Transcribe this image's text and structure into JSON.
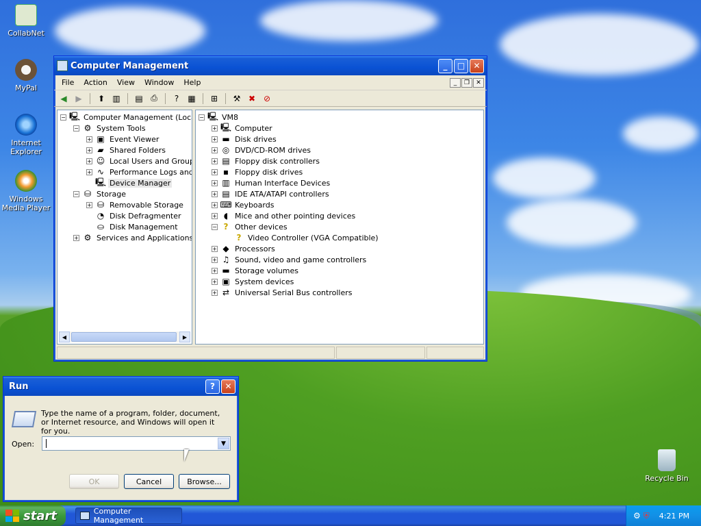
{
  "desktop": {
    "icons": [
      {
        "label": "CollabNet"
      },
      {
        "label": "MyPal"
      },
      {
        "label": "Internet Explorer"
      },
      {
        "label": "Windows Media Player"
      },
      {
        "label": "Recycle Bin"
      }
    ]
  },
  "cm_window": {
    "title": "Computer Management",
    "menu": [
      "File",
      "Action",
      "View",
      "Window",
      "Help"
    ],
    "left_tree": [
      {
        "label": "Computer Management (Local)",
        "level": 0,
        "expander": "-",
        "icon": "computer-icon"
      },
      {
        "label": "System Tools",
        "level": 1,
        "expander": "-",
        "icon": "tools-icon"
      },
      {
        "label": "Event Viewer",
        "level": 2,
        "expander": "+",
        "icon": "event-viewer-icon"
      },
      {
        "label": "Shared Folders",
        "level": 2,
        "expander": "+",
        "icon": "shared-folder-icon"
      },
      {
        "label": "Local Users and Groups",
        "level": 2,
        "expander": "+",
        "icon": "users-icon"
      },
      {
        "label": "Performance Logs and Alerts",
        "level": 2,
        "expander": "+",
        "icon": "performance-icon"
      },
      {
        "label": "Device Manager",
        "level": 2,
        "expander": "",
        "icon": "device-manager-icon",
        "selected": true
      },
      {
        "label": "Storage",
        "level": 1,
        "expander": "-",
        "icon": "storage-icon"
      },
      {
        "label": "Removable Storage",
        "level": 2,
        "expander": "+",
        "icon": "removable-storage-icon"
      },
      {
        "label": "Disk Defragmenter",
        "level": 2,
        "expander": "",
        "icon": "defrag-icon"
      },
      {
        "label": "Disk Management",
        "level": 2,
        "expander": "",
        "icon": "disk-management-icon"
      },
      {
        "label": "Services and Applications",
        "level": 1,
        "expander": "+",
        "icon": "services-icon"
      }
    ],
    "right_tree": [
      {
        "label": "VM8",
        "level": 0,
        "expander": "-",
        "icon": "computer-icon"
      },
      {
        "label": "Computer",
        "level": 1,
        "expander": "+",
        "icon": "computer-icon"
      },
      {
        "label": "Disk drives",
        "level": 1,
        "expander": "+",
        "icon": "disk-icon"
      },
      {
        "label": "DVD/CD-ROM drives",
        "level": 1,
        "expander": "+",
        "icon": "cdrom-icon"
      },
      {
        "label": "Floppy disk controllers",
        "level": 1,
        "expander": "+",
        "icon": "controller-icon"
      },
      {
        "label": "Floppy disk drives",
        "level": 1,
        "expander": "+",
        "icon": "floppy-icon"
      },
      {
        "label": "Human Interface Devices",
        "level": 1,
        "expander": "+",
        "icon": "hid-icon"
      },
      {
        "label": "IDE ATA/ATAPI controllers",
        "level": 1,
        "expander": "+",
        "icon": "ide-icon"
      },
      {
        "label": "Keyboards",
        "level": 1,
        "expander": "+",
        "icon": "keyboard-icon"
      },
      {
        "label": "Mice and other pointing devices",
        "level": 1,
        "expander": "+",
        "icon": "mouse-icon"
      },
      {
        "label": "Other devices",
        "level": 1,
        "expander": "-",
        "icon": "unknown-device-icon"
      },
      {
        "label": "Video Controller (VGA Compatible)",
        "level": 2,
        "expander": "",
        "icon": "warning-device-icon"
      },
      {
        "label": "Processors",
        "level": 1,
        "expander": "+",
        "icon": "processor-icon"
      },
      {
        "label": "Sound, video and game controllers",
        "level": 1,
        "expander": "+",
        "icon": "sound-icon"
      },
      {
        "label": "Storage volumes",
        "level": 1,
        "expander": "+",
        "icon": "storage-volume-icon"
      },
      {
        "label": "System devices",
        "level": 1,
        "expander": "+",
        "icon": "system-devices-icon"
      },
      {
        "label": "Universal Serial Bus controllers",
        "level": 1,
        "expander": "+",
        "icon": "usb-icon"
      }
    ]
  },
  "run_dialog": {
    "title": "Run",
    "description": "Type the name of a program, folder, document, or Internet resource, and Windows will open it for you.",
    "open_label": "Open:",
    "open_value": "",
    "ok_label": "OK",
    "cancel_label": "Cancel",
    "browse_label": "Browse..."
  },
  "taskbar": {
    "start_label": "start",
    "task_label": "Computer Management",
    "clock": "4:21 PM"
  }
}
